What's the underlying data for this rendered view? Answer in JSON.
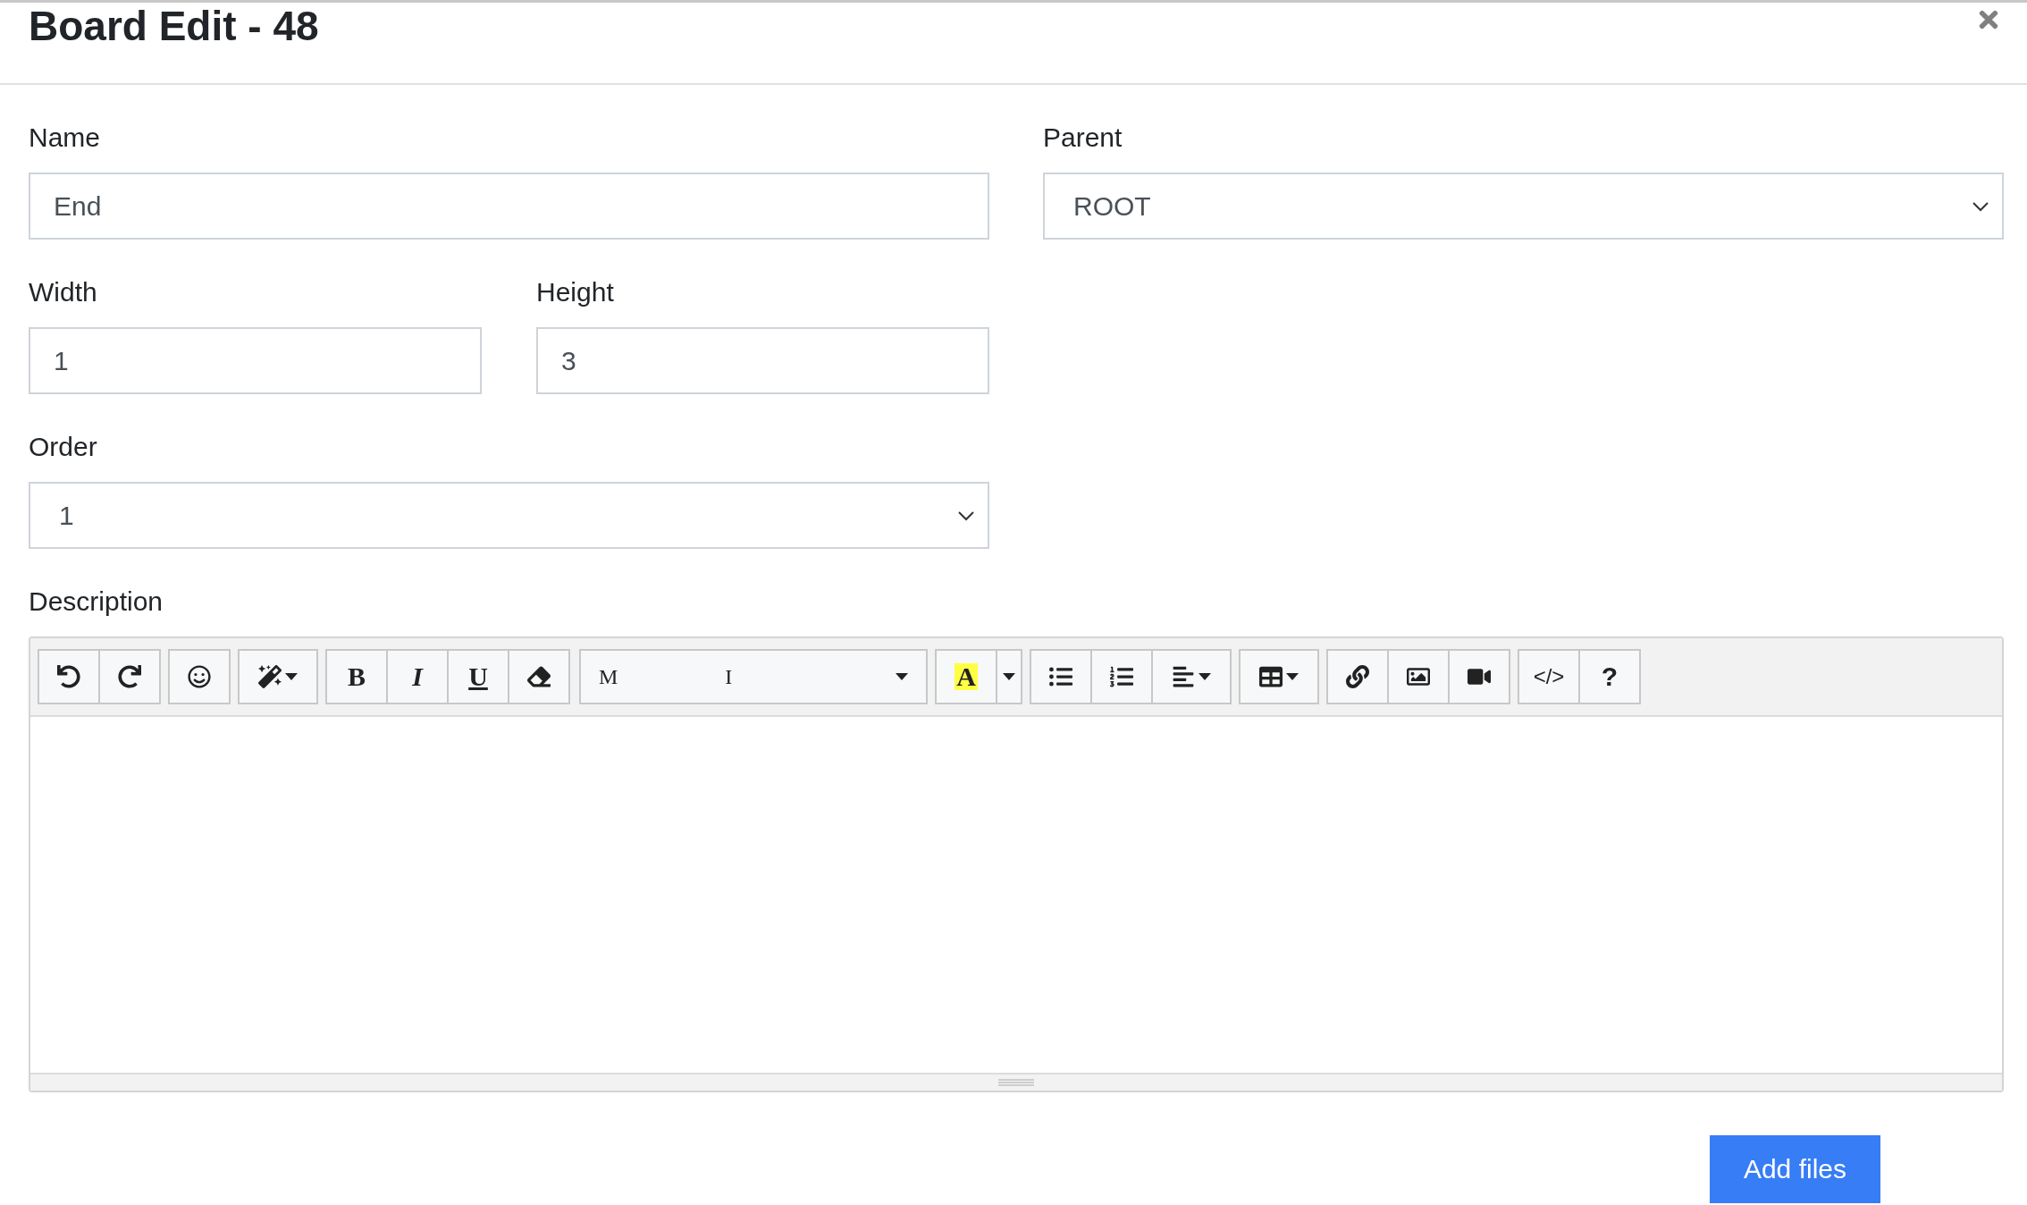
{
  "modal": {
    "title": "Board Edit - 48"
  },
  "fields": {
    "name": {
      "label": "Name",
      "value": "End"
    },
    "parent": {
      "label": "Parent",
      "value": "ROOT"
    },
    "width": {
      "label": "Width",
      "value": "1"
    },
    "height": {
      "label": "Height",
      "value": "3"
    },
    "order": {
      "label": "Order",
      "value": "1"
    }
  },
  "description": {
    "label": "Description",
    "toolbar": [
      [
        {
          "kind": "undo"
        },
        {
          "kind": "redo"
        }
      ],
      [
        {
          "kind": "emoji"
        }
      ],
      [
        {
          "kind": "magic"
        }
      ],
      [
        {
          "kind": "bold",
          "label": "B"
        },
        {
          "kind": "italic",
          "label": "I"
        },
        {
          "kind": "underline",
          "label": "U"
        },
        {
          "kind": "eraser"
        }
      ],
      [
        {
          "kind": "font",
          "label": "M",
          "label_2": "I"
        }
      ],
      [
        {
          "kind": "highlight",
          "label": "A"
        },
        {
          "kind": "caret"
        }
      ],
      [
        {
          "kind": "bullets"
        },
        {
          "kind": "numbers"
        },
        {
          "kind": "align"
        }
      ],
      [
        {
          "kind": "table"
        }
      ],
      [
        {
          "kind": "link"
        },
        {
          "kind": "image"
        },
        {
          "kind": "video"
        }
      ],
      [
        {
          "kind": "code",
          "label": "</>"
        },
        {
          "kind": "help",
          "label": "?"
        }
      ]
    ]
  },
  "actions": [
    {
      "label": "Add files"
    }
  ]
}
